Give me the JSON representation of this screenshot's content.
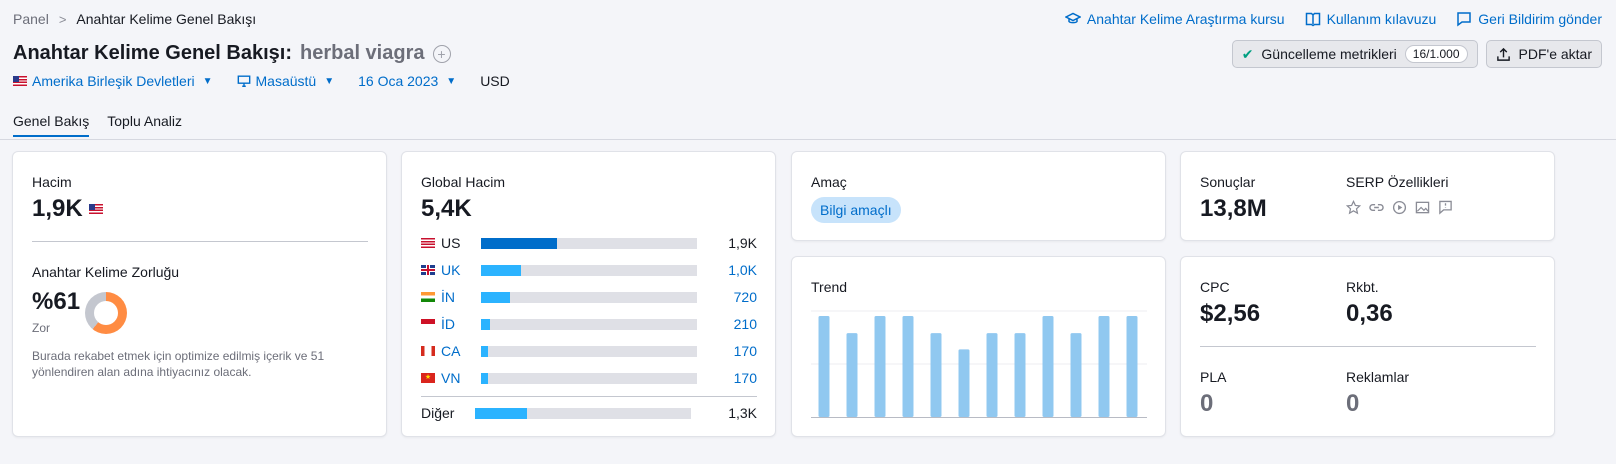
{
  "breadcrumb": {
    "root": "Panel",
    "current": "Anahtar Kelime Genel Bakışı"
  },
  "top_links": [
    {
      "label": "Anahtar Kelime Araştırma kursu",
      "icon": "graduation-cap-icon"
    },
    {
      "label": "Kullanım kılavuzu",
      "icon": "book-icon"
    },
    {
      "label": "Geri Bildirim gönder",
      "icon": "feedback-icon"
    }
  ],
  "page": {
    "title": "Anahtar Kelime Genel Bakışı:",
    "keyword": "herbal viagra"
  },
  "actions": {
    "update_label": "Güncelleme metrikleri",
    "update_count": "16/1.000",
    "export_label": "PDF'e aktar"
  },
  "filters": {
    "country": "Amerika Birleşik Devletleri",
    "device": "Masaüstü",
    "date": "16 Oca 2023",
    "currency": "USD"
  },
  "tabs": [
    "Genel Bakış",
    "Toplu Analiz"
  ],
  "volume": {
    "label": "Hacim",
    "value": "1,9K",
    "kd_label": "Anahtar Kelime Zorluğu",
    "kd_value": "%61",
    "kd_percent": 61,
    "kd_level": "Zor",
    "kd_description": "Burada rekabet etmek için optimize edilmiş içerik ve 51 yönlendiren alan adına ihtiyacınız olacak.",
    "colors": {
      "kd_fill": "#ff8c43",
      "kd_track": "#c4c7cf"
    }
  },
  "global_volume": {
    "label": "Global Hacim",
    "value": "5,4K",
    "rows": [
      {
        "code": "US",
        "value": "1,9K",
        "share": 0.35,
        "flag": "us"
      },
      {
        "code": "UK",
        "value": "1,0K",
        "share": 0.185,
        "flag": "uk"
      },
      {
        "code": "İN",
        "value": "720",
        "share": 0.135,
        "flag": "in"
      },
      {
        "code": "İD",
        "value": "210",
        "share": 0.04,
        "flag": "id"
      },
      {
        "code": "CA",
        "value": "170",
        "share": 0.032,
        "flag": "ca"
      },
      {
        "code": "VN",
        "value": "170",
        "share": 0.032,
        "flag": "vn"
      }
    ],
    "other": {
      "label": "Diğer",
      "value": "1,3K",
      "share": 0.24
    }
  },
  "intent": {
    "label": "Amaç",
    "badge": "Bilgi amaçlı"
  },
  "trend": {
    "label": "Trend",
    "chart_data": {
      "type": "bar",
      "values": [
        1.0,
        0.83,
        1.0,
        1.0,
        0.83,
        0.67,
        0.83,
        0.83,
        1.0,
        0.83,
        1.0,
        1.0
      ],
      "color": "#90c8f0"
    }
  },
  "results": {
    "label": "Sonuçlar",
    "value": "13,8M",
    "serp_label": "SERP Özellikleri",
    "serp_icons": [
      "star-icon",
      "link-icon",
      "play-icon",
      "image-icon",
      "faq-icon"
    ]
  },
  "cpc": {
    "label": "CPC",
    "value": "$2,56"
  },
  "competition": {
    "label": "Rkbt.",
    "value": "0,36"
  },
  "pla": {
    "label": "PLA",
    "value": "0"
  },
  "ads": {
    "label": "Reklamlar",
    "value": "0"
  }
}
